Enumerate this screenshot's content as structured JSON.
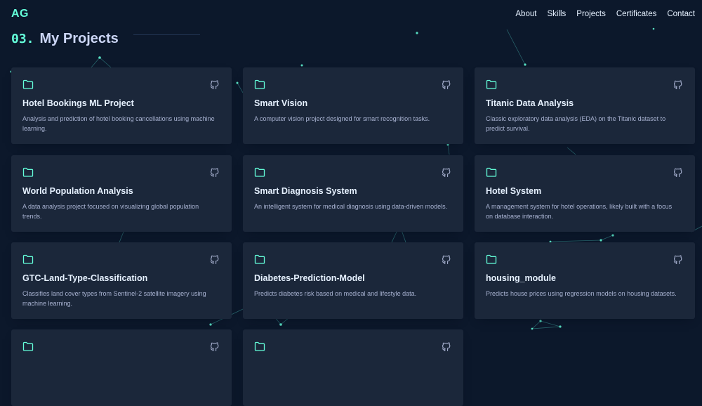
{
  "brand": {
    "logo": "AG",
    "accent_color": "#64ffda",
    "background_color": "#0c182b",
    "card_color": "#1b273a"
  },
  "nav": {
    "links": [
      {
        "label": "About"
      },
      {
        "label": "Skills"
      },
      {
        "label": "Projects"
      },
      {
        "label": "Certificates"
      },
      {
        "label": "Contact"
      }
    ]
  },
  "section": {
    "number": "03.",
    "title": "My Projects"
  },
  "projects": [
    {
      "title": "Hotel Bookings ML Project",
      "description": "Analysis and prediction of hotel booking cancellations using machine learning.",
      "icon": "folder-icon",
      "link_icon": "github-icon"
    },
    {
      "title": "Smart Vision",
      "description": "A computer vision project designed for smart recognition tasks.",
      "icon": "folder-icon",
      "link_icon": "github-icon"
    },
    {
      "title": "Titanic Data Analysis",
      "description": "Classic exploratory data analysis (EDA) on the Titanic dataset to predict survival.",
      "icon": "folder-icon",
      "link_icon": "github-icon"
    },
    {
      "title": "World Population Analysis",
      "description": "A data analysis project focused on visualizing global population trends.",
      "icon": "folder-icon",
      "link_icon": "github-icon"
    },
    {
      "title": "Smart Diagnosis System",
      "description": "An intelligent system for medical diagnosis using data-driven models.",
      "icon": "folder-icon",
      "link_icon": "github-icon"
    },
    {
      "title": "Hotel System",
      "description": "A management system for hotel operations, likely built with a focus on database interaction.",
      "icon": "folder-icon",
      "link_icon": "github-icon"
    },
    {
      "title": "GTC-Land-Type-Classification",
      "description": "Classifies land cover types from Sentinel-2 satellite imagery using machine learning.",
      "icon": "folder-icon",
      "link_icon": "github-icon"
    },
    {
      "title": "Diabetes-Prediction-Model",
      "description": "Predicts diabetes risk based on medical and lifestyle data.",
      "icon": "folder-icon",
      "link_icon": "github-icon"
    },
    {
      "title": "housing_module",
      "description": "Predicts house prices using regression models on housing datasets.",
      "icon": "folder-icon",
      "link_icon": "github-icon"
    },
    {
      "title": "",
      "description": "",
      "icon": "folder-icon",
      "link_icon": "github-icon"
    },
    {
      "title": "",
      "description": "",
      "icon": "folder-icon",
      "link_icon": "github-icon"
    }
  ]
}
